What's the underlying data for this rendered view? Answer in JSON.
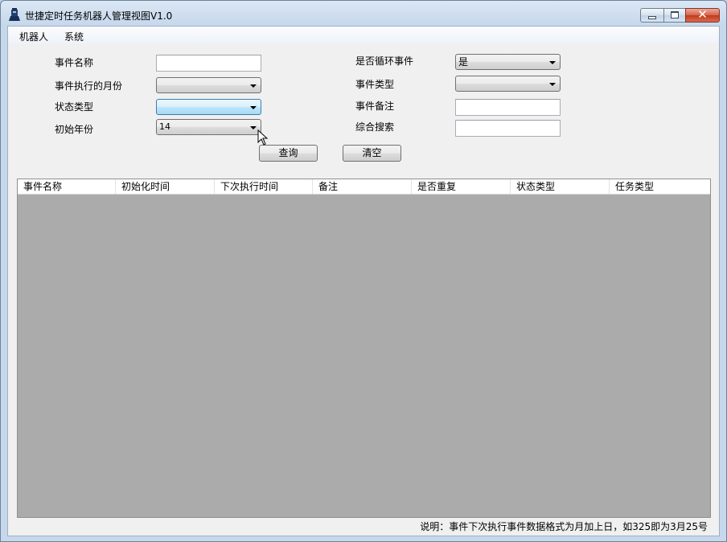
{
  "window": {
    "title": "世捷定时任务机器人管理视图V1.0",
    "icon": "robot-app-icon"
  },
  "menu": {
    "items": [
      "机器人",
      "系统"
    ]
  },
  "form": {
    "event_name_label": "事件名称",
    "event_name_value": "",
    "event_month_label": "事件执行的月份",
    "event_month_value": "",
    "status_type_label": "状态类型",
    "status_type_value": "",
    "start_year_label": "初始年份",
    "start_year_value": "14",
    "loop_label": "是否循环事件",
    "loop_value": "是",
    "event_type_label": "事件类型",
    "event_type_value": "",
    "event_note_label": "事件备注",
    "event_note_value": "",
    "search_label": "综合搜索",
    "search_value": ""
  },
  "buttons": {
    "query": "查询",
    "clear": "清空"
  },
  "grid": {
    "columns": [
      "事件名称",
      "初始化时间",
      "下次执行时间",
      "备注",
      "是否重复",
      "状态类型",
      "任务类型"
    ],
    "rows": []
  },
  "footer": {
    "note": "说明：事件下次执行事件数据格式为月加上日，如325即为3月25号"
  },
  "colors": {
    "grid_background": "#ababab",
    "client_background": "#f0f0f0",
    "close_button": "#c4381a"
  }
}
